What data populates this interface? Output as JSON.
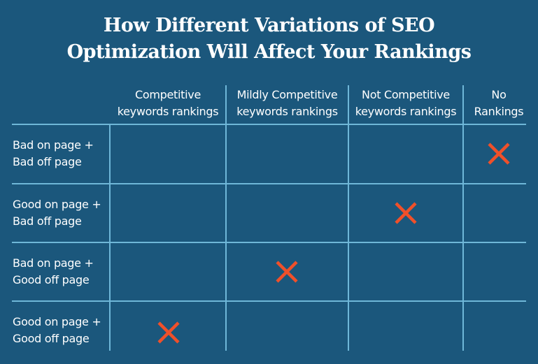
{
  "title": {
    "line1": "How Different Variations of SEO",
    "line2": "Optimization Will Affect Your Rankings"
  },
  "columns": [
    {
      "line1": "Competitive",
      "line2": "keywords rankings"
    },
    {
      "line1": "Mildly Competitive",
      "line2": "keywords rankings"
    },
    {
      "line1": "Not Competitive",
      "line2": "keywords rankings"
    },
    {
      "line1": "No",
      "line2": "Rankings"
    }
  ],
  "rows": [
    {
      "line1": "Bad on page +",
      "line2": "Bad off page",
      "marked_column": 3
    },
    {
      "line1": "Good on page +",
      "line2": "Bad off page",
      "marked_column": 2
    },
    {
      "line1": "Bad on page +",
      "line2": "Good off page",
      "marked_column": 1
    },
    {
      "line1": "Good on page +",
      "line2": "Good off page",
      "marked_column": 0
    }
  ],
  "mark_icon": "x-mark-icon",
  "colors": {
    "background": "#1b577c",
    "grid": "#6fb7d8",
    "mark": "#f0502a",
    "text": "#ffffff"
  }
}
